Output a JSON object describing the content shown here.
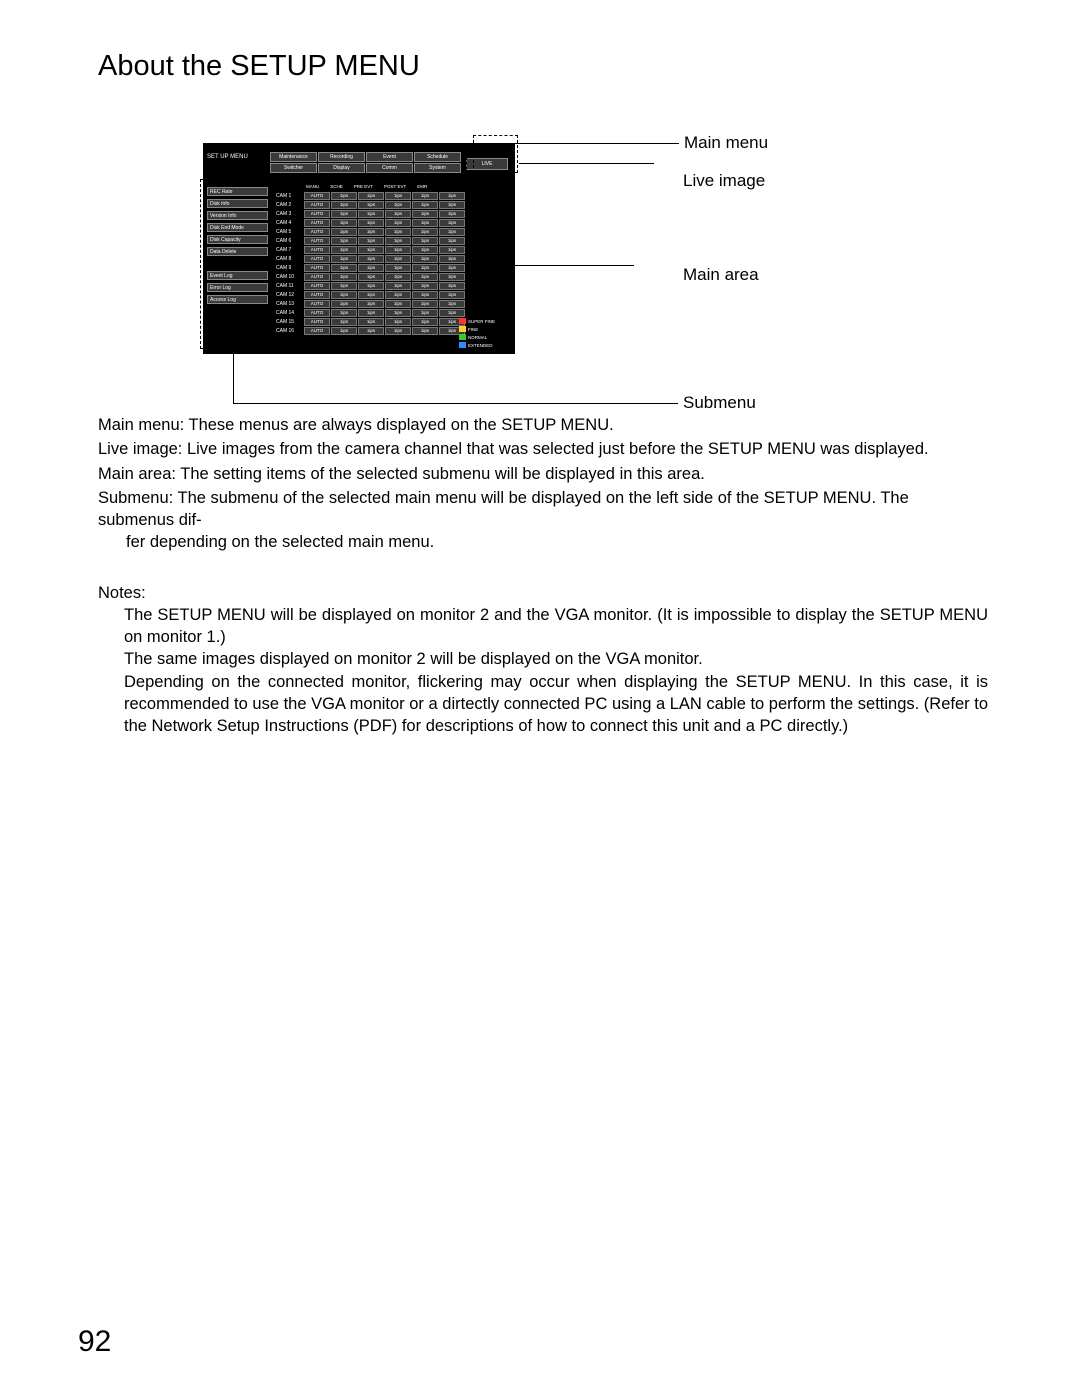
{
  "page_title": "About the SETUP MENU",
  "page_number": "92",
  "annotations": {
    "main_menu": "Main menu",
    "live_image": "Live image",
    "main_area": "Main area",
    "submenu": "Submenu"
  },
  "setup": {
    "label": "SET UP MENU",
    "live_button": "LIVE",
    "tabs": [
      "Maintenance",
      "Recording",
      "Event",
      "Schedule",
      "Switcher",
      "Display",
      "Comm",
      "System"
    ],
    "submenus": [
      "REC Rate",
      "Disk Info",
      "Version Info",
      "Disk End Mode",
      "Disk Capacity",
      "Data Delete",
      "",
      "Event Log",
      "Error Log",
      "Access Log"
    ],
    "columns": [
      "MANU",
      "SCHE",
      "PRE EVT",
      "POST EVT",
      "EMR"
    ],
    "cameras": [
      "CAM 1",
      "CAM 2",
      "CAM 3",
      "CAM 4",
      "CAM 5",
      "CAM 6",
      "CAM 7",
      "CAM 8",
      "CAM 9",
      "CAM 10",
      "CAM 11",
      "CAM 12",
      "CAM 13",
      "CAM 14",
      "CAM 15",
      "CAM 16"
    ],
    "cell_auto": "AUTO",
    "cell_ips": "1ips",
    "legend": [
      {
        "label": "SUPER FINE",
        "color": "#ff3333"
      },
      {
        "label": "FINE",
        "color": "#ffcc33"
      },
      {
        "label": "NORMAL",
        "color": "#33cc33"
      },
      {
        "label": "EXTENDED",
        "color": "#3388ff"
      }
    ]
  },
  "descriptions": {
    "main_menu": "Main menu:  These menus are always displayed on the SETUP MENU.",
    "live_image": "Live image:  Live images from the camera channel that was selected just before the SETUP MENU was displayed.",
    "main_area": "Main area:  The setting items of the selected submenu will be displayed in this area.",
    "submenu1": "Submenu:  The submenu of the selected main menu will be displayed on the left side of the SETUP MENU. The submenus dif-",
    "submenu2": "fer depending on the selected main menu."
  },
  "notes_label": "Notes:",
  "notes": [
    "The SETUP MENU will be displayed on monitor 2 and the VGA monitor. (It is impossible to display the SETUP MENU on monitor 1.)",
    "The same images displayed on monitor 2 will be displayed on the VGA monitor.",
    "Depending on the connected monitor, flickering may occur when displaying the SETUP MENU. In this case, it is recommended to use the VGA monitor or a dirtectly connected PC using a LAN cable to perform the settings. (Refer to the Network Setup Instructions (PDF) for descriptions of how to connect this unit and a PC directly.)"
  ]
}
